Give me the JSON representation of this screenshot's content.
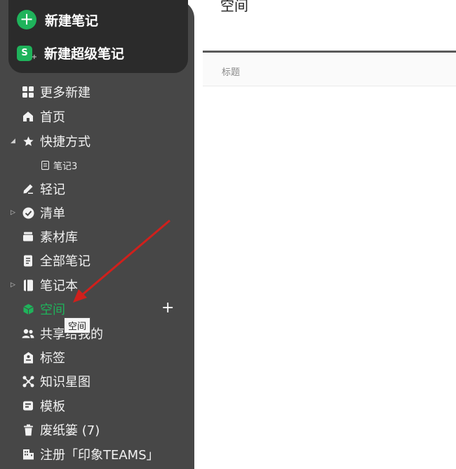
{
  "new_actions": {
    "new_note": "新建笔记",
    "new_super_note": "新建超级笔记",
    "super_note_icon_letter": "S"
  },
  "nav": {
    "items": [
      {
        "label": "更多新建",
        "icon": "grid-icon"
      },
      {
        "label": "首页",
        "icon": "home-icon"
      },
      {
        "label": "快捷方式",
        "icon": "star-icon",
        "expanded": true
      },
      {
        "label": "笔记3",
        "icon": "note-icon",
        "child": true
      },
      {
        "label": "轻记",
        "icon": "pen-icon"
      },
      {
        "label": "清单",
        "icon": "check-circle-icon",
        "expanded": false
      },
      {
        "label": "素材库",
        "icon": "box-icon"
      },
      {
        "label": "全部笔记",
        "icon": "notes-icon"
      },
      {
        "label": "笔记本",
        "icon": "notebook-icon",
        "expanded": false
      },
      {
        "label": "空间",
        "icon": "cube-icon",
        "active": true
      },
      {
        "label": "共享给我的",
        "icon": "people-icon"
      },
      {
        "label": "标签",
        "icon": "tag-icon"
      },
      {
        "label": "知识星图",
        "icon": "graph-icon"
      },
      {
        "label": "模板",
        "icon": "template-icon"
      },
      {
        "label": "废纸篓 (7)",
        "icon": "trash-icon"
      },
      {
        "label": "注册「印象TEAMS」",
        "icon": "building-icon"
      }
    ],
    "add_space": "+",
    "tooltip": "空间"
  },
  "main": {
    "title": "空间",
    "column_title": "标题"
  },
  "colors": {
    "accent": "#1fb35b",
    "sidebar_bg": "#474747",
    "new_box_bg": "#2b2b2b",
    "arrow": "#d0201c"
  }
}
